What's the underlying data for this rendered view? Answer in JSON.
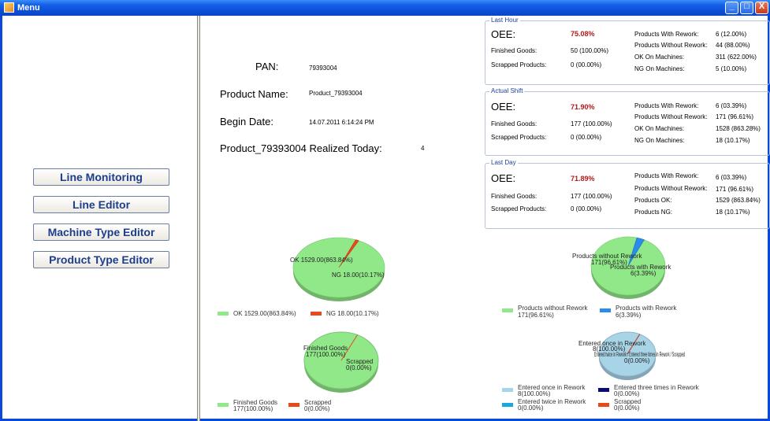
{
  "window": {
    "title": "Menu",
    "minimize": "_",
    "maximize": "□",
    "close": "X"
  },
  "nav": {
    "line_monitoring": "Line Monitoring",
    "line_editor": "Line Editor",
    "machine_type_editor": "Machine Type Editor",
    "product_type_editor": "Product Type Editor"
  },
  "product": {
    "pan_label": "PAN:",
    "pan_value": "79393004",
    "name_label": "Product Name:",
    "name_value": "Product_79393004",
    "begin_label": "Begin Date:",
    "begin_value": "14.07.2011 6:14:24 PM",
    "realized_label": "Product_79393004 Realized Today:",
    "realized_value": "4"
  },
  "last_hour": {
    "title": "Last Hour",
    "oee_label": "OEE:",
    "oee_value": "75.08%",
    "finished_label": "Finished Goods:",
    "finished_value": "50 (100.00%)",
    "scrapped_label": "Scrapped Products:",
    "scrapped_value": "0 (00.00%)",
    "with_rework_label": "Products With Rework:",
    "with_rework_value": "6 (12.00%)",
    "without_rework_label": "Products Without Rework:",
    "without_rework_value": "44 (88.00%)",
    "ok_label": "OK On Machines:",
    "ok_value": "311 (622.00%)",
    "ng_label": "NG On Machines:",
    "ng_value": "5 (10.00%)"
  },
  "actual_shift": {
    "title": "Actual Shift",
    "oee_label": "OEE:",
    "oee_value": "71.90%",
    "finished_label": "Finished Goods:",
    "finished_value": "177 (100.00%)",
    "scrapped_label": "Scrapped Products:",
    "scrapped_value": "0 (00.00%)",
    "with_rework_label": "Products With Rework:",
    "with_rework_value": "6 (03.39%)",
    "without_rework_label": "Products Without Rework:",
    "without_rework_value": "171 (96.61%)",
    "ok_label": "OK On Machines:",
    "ok_value": "1528 (863.28%)",
    "ng_label": "NG On Machines:",
    "ng_value": "18 (10.17%)"
  },
  "last_day": {
    "title": "Last Day",
    "oee_label": "OEE:",
    "oee_value": "71.89%",
    "finished_label": "Finished Goods:",
    "finished_value": "177 (100.00%)",
    "scrapped_label": "Scrapped Products:",
    "scrapped_value": "0 (00.00%)",
    "with_rework_label": "Products With Rework:",
    "with_rework_value": "6 (03.39%)",
    "without_rework_label": "Products Without Rework:",
    "without_rework_value": "171 (96.61%)",
    "ok_label": "Products OK:",
    "ok_value": "1529 (863.84%)",
    "ng_label": "Products NG:",
    "ng_value": "18 (10.17%)"
  },
  "colors": {
    "green": "#90e888",
    "red": "#e84a1a",
    "blue": "#2a8ce8",
    "lightblue": "#a8d4e8",
    "navy": "#0a0a78",
    "cyan": "#18a8e0"
  },
  "charts": {
    "ok_ng": {
      "label_ok": "OK  1529.00(863.84%)",
      "label_ng": "NG 18.00(10.17%)",
      "legend_ok": "OK  1529.00(863.84%)",
      "legend_ng": "NG 18.00(10.17%)"
    },
    "rework": {
      "label_without_1": "Products without Rework",
      "label_without_2": "171(96.61%)",
      "label_with_1": "Products with Rework",
      "label_with_2": "6(3.39%)",
      "legend_without_1": "Products without Rework",
      "legend_without_2": "171(96.61%)",
      "legend_with_1": "Products with Rework",
      "legend_with_2": "6(3.39%)"
    },
    "finished": {
      "label_finished_1": "Finished Goods",
      "label_finished_2": "177(100.00%)",
      "label_scrapped_1": "Scrapped",
      "label_scrapped_2": "0(0.00%)",
      "legend_finished_1": "Finished Goods",
      "legend_finished_2": "177(100.00%)",
      "legend_scrapped_1": "Scrapped",
      "legend_scrapped_2": "0(0.00%)"
    },
    "entered": {
      "label_once_1": "Entered once in Rework",
      "label_once_2": "8(100.00%)",
      "label_overlap": "Entered twice in Rework / Entered three times in Rework / Scrapped",
      "label_zero": "0(0.00%)",
      "legend_once_1": "Entered once in Rework",
      "legend_once_2": "8(100.00%)",
      "legend_three_1": "Entered three times in Rework",
      "legend_three_2": "0(0.00%)",
      "legend_twice_1": "Entered twice in Rework",
      "legend_twice_2": "0(0.00%)",
      "legend_scrapped_1": "Scrapped",
      "legend_scrapped_2": "0(0.00%)"
    }
  },
  "chart_data": [
    {
      "type": "pie",
      "categories": [
        "OK",
        "NG"
      ],
      "values": [
        1529.0,
        18.0
      ]
    },
    {
      "type": "pie",
      "categories": [
        "Products without Rework",
        "Products with Rework"
      ],
      "values": [
        171,
        6
      ]
    },
    {
      "type": "pie",
      "categories": [
        "Finished Goods",
        "Scrapped"
      ],
      "values": [
        177,
        0
      ]
    },
    {
      "type": "pie",
      "categories": [
        "Entered once in Rework",
        "Entered twice in Rework",
        "Entered three times in Rework",
        "Scrapped"
      ],
      "values": [
        8,
        0,
        0,
        0
      ]
    }
  ]
}
